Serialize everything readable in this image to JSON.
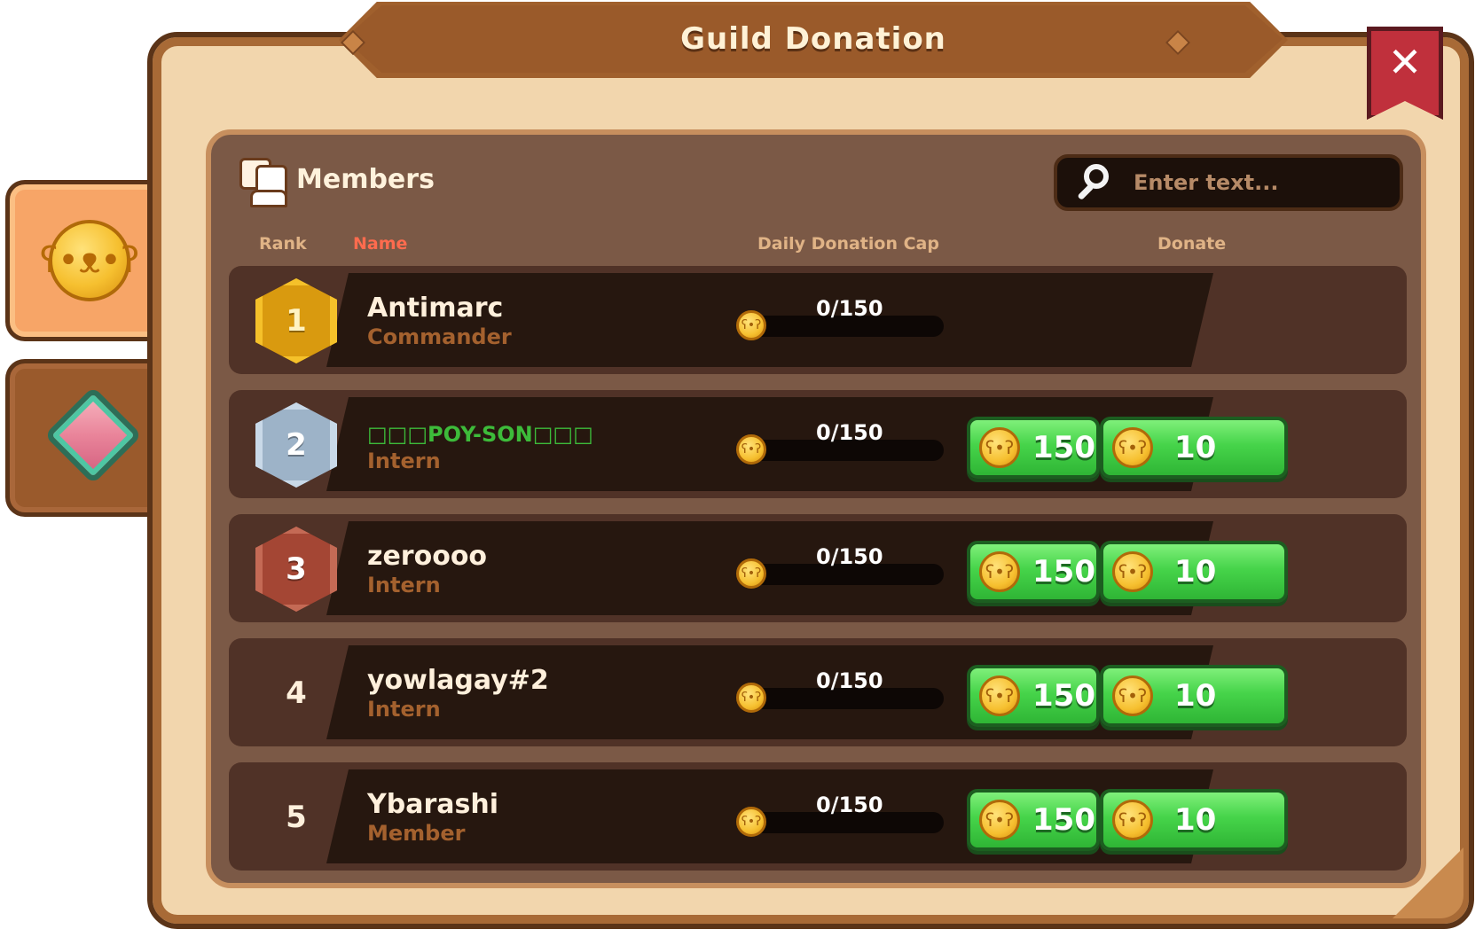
{
  "window": {
    "title": "Guild Donation",
    "close_label": "✕"
  },
  "side_tabs": [
    {
      "name": "coin-tab",
      "icon": "coin-icon",
      "active": true
    },
    {
      "name": "gem-tab",
      "icon": "gem-icon",
      "active": false
    }
  ],
  "members_section": {
    "label": "Members",
    "search_placeholder": "Enter text..."
  },
  "columns": {
    "rank": "Rank",
    "name": "Name",
    "cap": "Daily Donation Cap",
    "donate": "Donate"
  },
  "rows": [
    {
      "rank": "1",
      "badge": "gold",
      "name": "Antimarc",
      "role": "Commander",
      "cap_text": "0/150",
      "cap_fraction": 0,
      "show_donate": false
    },
    {
      "rank": "2",
      "badge": "silver",
      "name": "□□□POY-SON□□□",
      "role": "Intern",
      "cap_text": "0/150",
      "cap_fraction": 0,
      "show_donate": true
    },
    {
      "rank": "3",
      "badge": "bronze",
      "name": "zeroooo",
      "role": "Intern",
      "cap_text": "0/150",
      "cap_fraction": 0,
      "show_donate": true
    },
    {
      "rank": "4",
      "badge": "none",
      "name": "yowlagay#2",
      "role": "Intern",
      "cap_text": "0/150",
      "cap_fraction": 0,
      "show_donate": true
    },
    {
      "rank": "5",
      "badge": "none",
      "name": "Ybarashi",
      "role": "Member",
      "cap_text": "0/150",
      "cap_fraction": 0,
      "show_donate": true
    }
  ],
  "donate_buttons": {
    "large": "150",
    "small": "10"
  },
  "colors": {
    "accent_green": "#46d44a",
    "gold": "#f5c12a",
    "name_highlight": "#3dbb3a",
    "close_red": "#c0303c"
  }
}
